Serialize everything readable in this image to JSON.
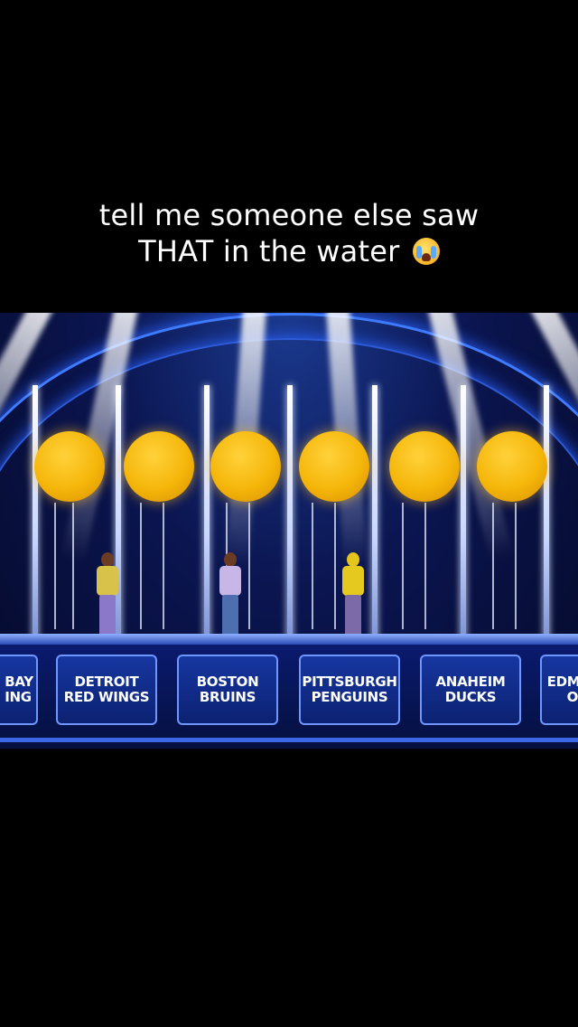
{
  "caption": {
    "line1": "tell me someone else saw",
    "line2": "THAT in the water",
    "emoji": "loudly-crying-face"
  },
  "scene": {
    "ball_count": 6,
    "ball_color": "#f5b60a",
    "stage_color": "#0b1550",
    "teams": [
      {
        "line1": "BAY",
        "line2": "ING"
      },
      {
        "line1": "DETROIT",
        "line2": "RED WINGS"
      },
      {
        "line1": "BOSTON",
        "line2": "BRUINS"
      },
      {
        "line1": "PITTSBURGH",
        "line2": "PENGUINS"
      },
      {
        "line1": "ANAHEIM",
        "line2": "DUCKS"
      },
      {
        "line1": "EDM",
        "line2": "O"
      }
    ]
  }
}
